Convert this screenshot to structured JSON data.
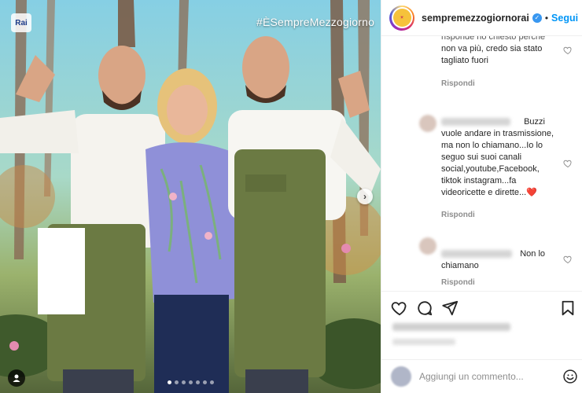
{
  "photo": {
    "channel_logo": "Rai",
    "hashtag": "#ÈSempreMezzogiorno",
    "carousel": {
      "total": 7,
      "active": 0
    },
    "icons": {
      "next": "chevron-right-icon",
      "tag_users": "person-icon"
    }
  },
  "header": {
    "username": "sempremezzogiornorai",
    "separator": "•",
    "follow_label": "Segui",
    "verified_icon": "verified-badge-icon"
  },
  "comments": [
    {
      "text": "tagliato fuori",
      "partial_lines": [
        "...rispoude ho chiesto perché non va più, credo sia stato"
      ],
      "lines": [
        "risponde ho chiesto perché",
        "non va più, credo sia stato",
        "tagliato fuori"
      ],
      "reply_label": "Rispondi"
    },
    {
      "lines": [
        "Buzzi",
        "vuole andare in trasmissione,",
        "ma non lo chiamano...Io lo",
        "seguo sui suoi canali",
        "social,youtube,Facebook,",
        "tiktok instagram...fa",
        "videoricette e dirette...❤️"
      ],
      "reply_label": "Rispondi"
    },
    {
      "lines": [
        "Non lo",
        "chiamano"
      ],
      "reply_label": "Rispondi"
    }
  ],
  "actions": {
    "like_icon": "heart-icon",
    "comment_icon": "comment-icon",
    "share_icon": "send-icon",
    "save_icon": "bookmark-icon"
  },
  "comment_box": {
    "placeholder": "Aggiungi un commento...",
    "emoji_icon": "emoji-icon"
  },
  "colors": {
    "follow_blue": "#0095f6",
    "apron_green": "#6b7a43",
    "heart_red": "#e0245e"
  }
}
